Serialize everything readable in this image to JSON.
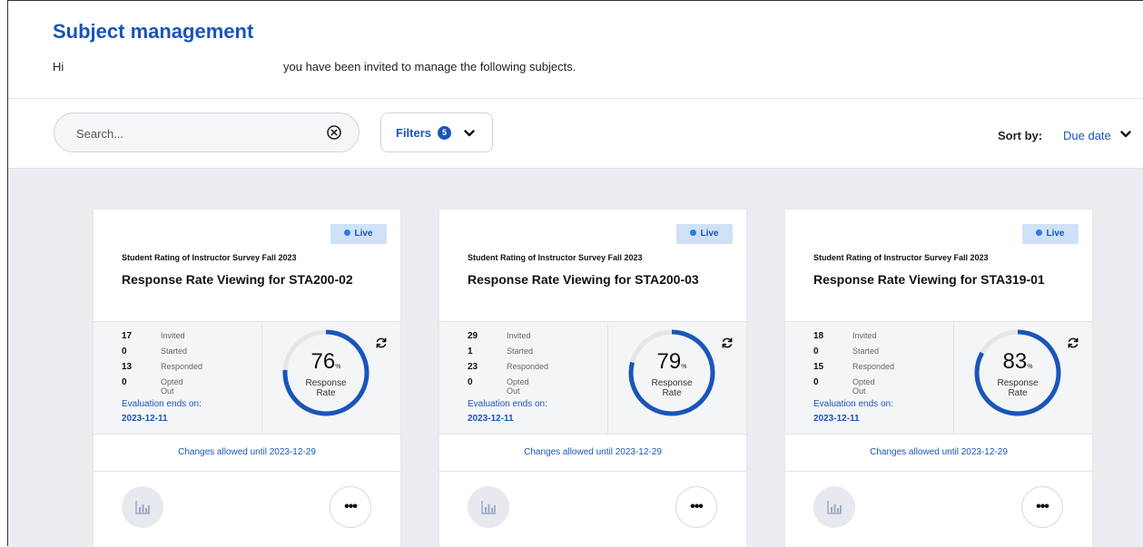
{
  "header": {
    "title": "Subject management",
    "greeting_hi": "Hi",
    "greeting_rest": "you have been invited to manage the following subjects."
  },
  "toolbar": {
    "search_placeholder": "Search...",
    "filters_label": "Filters",
    "filters_count": "5",
    "sort_label": "Sort by:",
    "sort_value": "Due date"
  },
  "cards": [
    {
      "status": "Live",
      "survey": "Student Rating of Instructor Survey Fall 2023",
      "title": "Response Rate Viewing for STA200-02",
      "invited": "17",
      "started": "0",
      "responded": "13",
      "opted_out": "0",
      "invited_label": "Invited",
      "started_label": "Started",
      "responded_label": "Responded",
      "opted_out_label": "Opted Out",
      "eval_label": "Evaluation ends on:",
      "eval_date": "2023-12-11",
      "rate": 76,
      "rate_text": "76",
      "rate_unit": "%",
      "rate_label_1": "Response",
      "rate_label_2": "Rate",
      "changes": "Changes allowed until 2023-12-29"
    },
    {
      "status": "Live",
      "survey": "Student Rating of Instructor Survey Fall 2023",
      "title": "Response Rate Viewing for STA200-03",
      "invited": "29",
      "started": "1",
      "responded": "23",
      "opted_out": "0",
      "invited_label": "Invited",
      "started_label": "Started",
      "responded_label": "Responded",
      "opted_out_label": "Opted Out",
      "eval_label": "Evaluation ends on:",
      "eval_date": "2023-12-11",
      "rate": 79,
      "rate_text": "79",
      "rate_unit": "%",
      "rate_label_1": "Response",
      "rate_label_2": "Rate",
      "changes": "Changes allowed until 2023-12-29"
    },
    {
      "status": "Live",
      "survey": "Student Rating of Instructor Survey Fall 2023",
      "title": "Response Rate Viewing for STA319-01",
      "invited": "18",
      "started": "0",
      "responded": "15",
      "opted_out": "0",
      "invited_label": "Invited",
      "started_label": "Started",
      "responded_label": "Responded",
      "opted_out_label": "Opted Out",
      "eval_label": "Evaluation ends on:",
      "eval_date": "2023-12-11",
      "rate": 83,
      "rate_text": "83",
      "rate_unit": "%",
      "rate_label_1": "Response",
      "rate_label_2": "Rate",
      "changes": "Changes allowed until 2023-12-29"
    }
  ],
  "colors": {
    "accent": "#1a55b8",
    "live_bg": "#cfe1f7",
    "page_bg": "#ebedf1",
    "gauge_track": "#e4e6ea"
  },
  "icons": {
    "clear": "x-circle-icon",
    "chevron": "chevron-down-icon",
    "refresh": "refresh-icon",
    "chart": "bar-chart-icon",
    "more": "more-horizontal-icon"
  }
}
